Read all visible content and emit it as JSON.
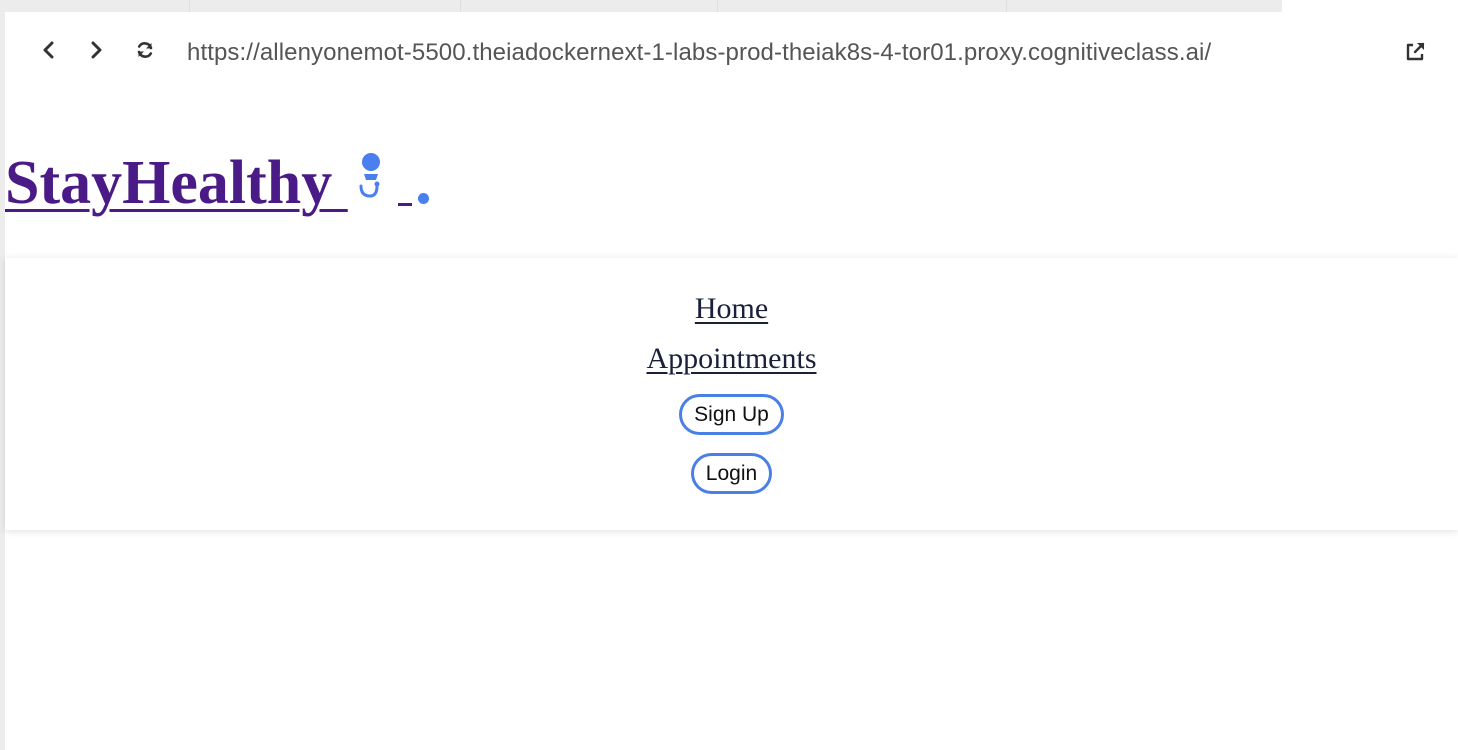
{
  "browser": {
    "url": "https://allenyonemot-5500.theiadockernext-1-labs-prod-theiak8s-4-tor01.proxy.cognitiveclass.ai/",
    "icons": {
      "back": "chevron-left-icon",
      "forward": "chevron-right-icon",
      "reload": "refresh-icon",
      "open_external": "external-link-icon"
    }
  },
  "header": {
    "brand_text": "StayHealthy ",
    "logo_icon": "doctor-stethoscope-icon",
    "brand_color": "#4a1a86",
    "accent_color": "#4a80ee"
  },
  "nav": {
    "home_label": "Home",
    "appointments_label": "Appointments",
    "signup_label": "Sign Up",
    "login_label": "Login",
    "button_border_color": "#4a80e6"
  }
}
